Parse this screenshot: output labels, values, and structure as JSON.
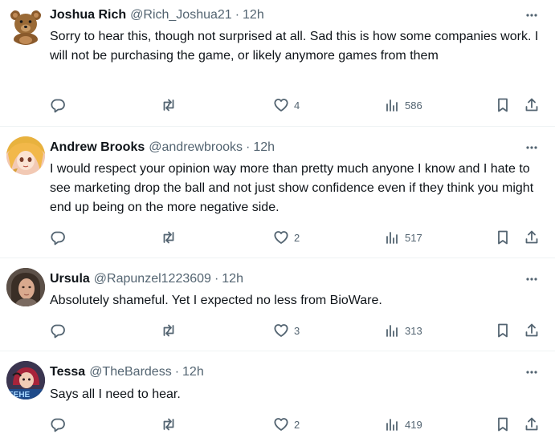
{
  "tweets": [
    {
      "name": "Joshua Rich",
      "handle": "@Rich_Joshua21",
      "sep": "·",
      "time": "12h",
      "text": "Sorry to hear this, though not surprised at all.  Sad this is how some companies work.  I will not be purchasing the game, or likely anymore games from them",
      "replies": "",
      "retweets": "",
      "likes": "4",
      "views": "586",
      "avatar_icon": "teddy-bear-avatar"
    },
    {
      "name": "Andrew Brooks",
      "handle": "@andrewbrooks",
      "sep": "·",
      "time": "12h",
      "text": "I would respect your opinion way more than pretty much anyone I know and I hate to see marketing drop the ball and not just show confidence even if they think you might end up being on the more negative side.",
      "replies": "",
      "retweets": "",
      "likes": "2",
      "views": "517",
      "avatar_icon": "anime-character-avatar"
    },
    {
      "name": "Ursula",
      "handle": "@Rapunzel1223609",
      "sep": "·",
      "time": "12h",
      "text": "Absolutely shameful. Yet I expected no less from BioWare.",
      "replies": "",
      "retweets": "",
      "likes": "3",
      "views": "313",
      "avatar_icon": "portrait-avatar"
    },
    {
      "name": "Tessa",
      "handle": "@TheBardess",
      "sep": "·",
      "time": "12h",
      "text": "Says all I need to hear.",
      "replies": "",
      "retweets": "",
      "likes": "2",
      "views": "419",
      "avatar_icon": "illustrated-character-avatar",
      "avatar_text": "EEHE"
    }
  ],
  "colors": {
    "text": "#0f1419",
    "secondary": "#536471",
    "divider": "#eff3f4"
  },
  "icons": {
    "more": "more-dots-icon",
    "reply": "reply-icon",
    "retweet": "retweet-icon",
    "like": "heart-icon",
    "views": "views-bar-chart-icon",
    "bookmark": "bookmark-icon",
    "share": "share-icon"
  }
}
